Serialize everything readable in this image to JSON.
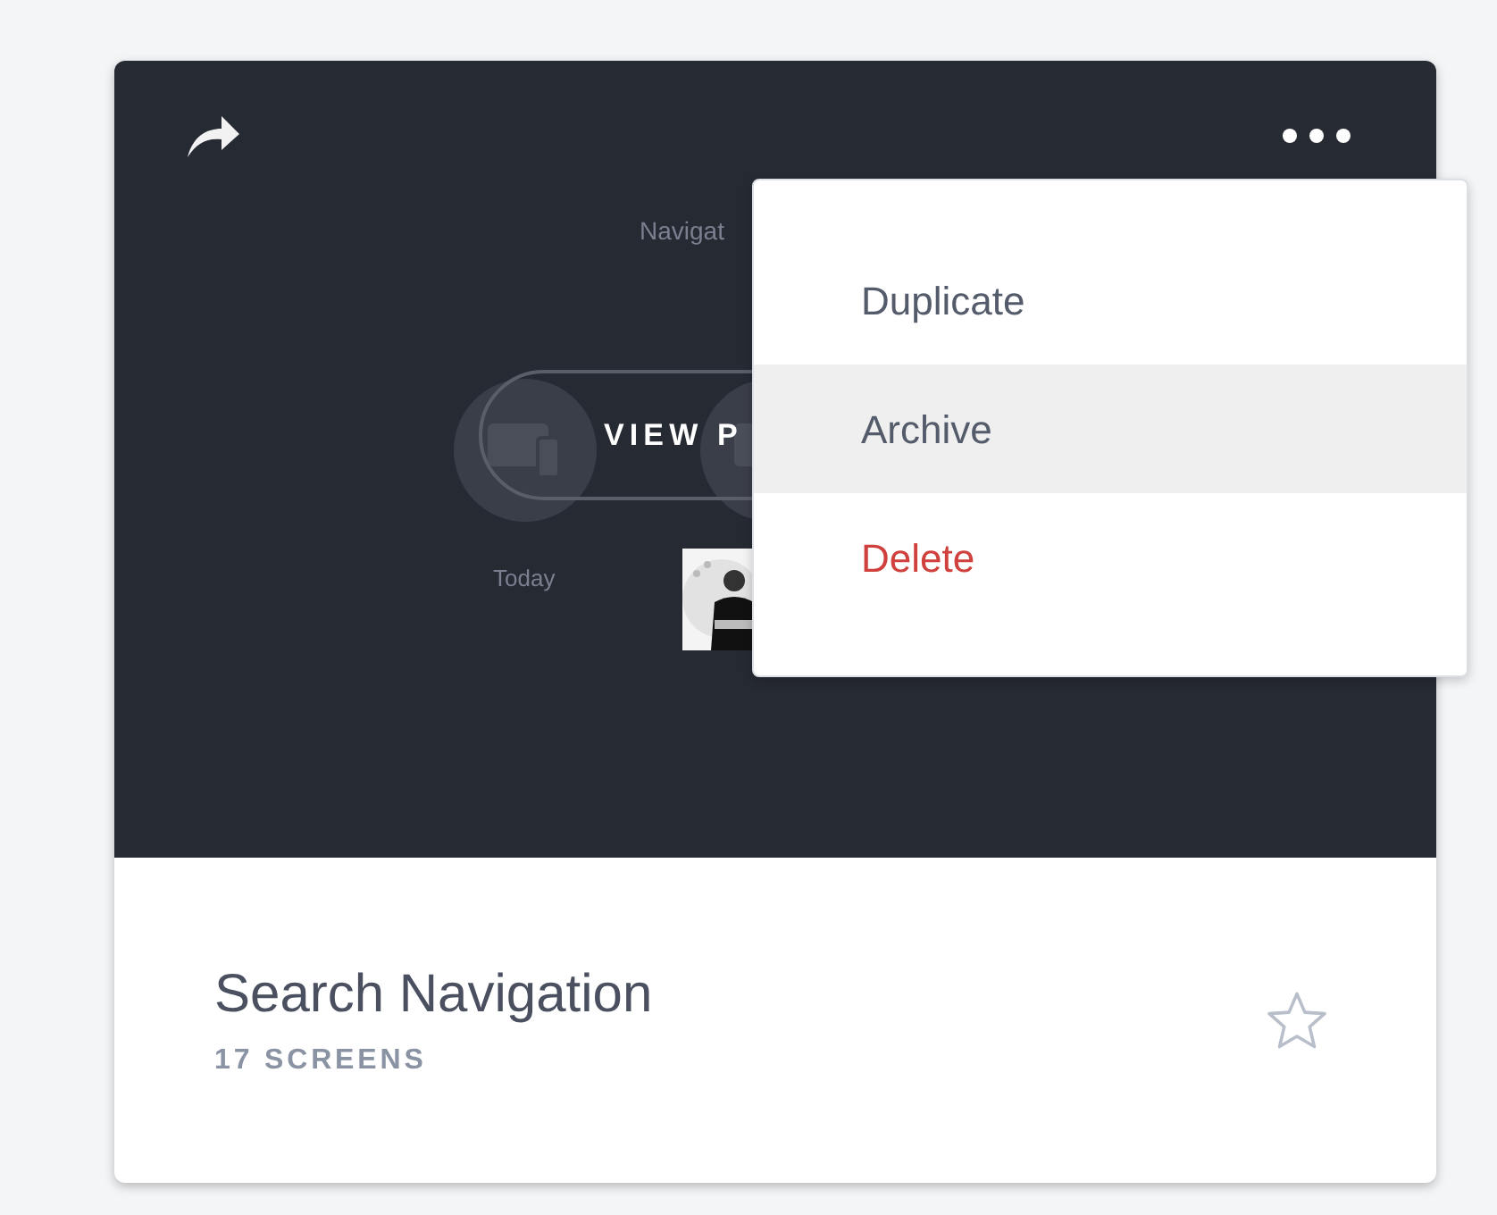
{
  "preview": {
    "hint": "Navigat",
    "button": "VIEW P",
    "caption": "Today"
  },
  "menu": {
    "items": [
      {
        "label": "Duplicate",
        "selected": false,
        "kind": "normal"
      },
      {
        "label": "Archive",
        "selected": true,
        "kind": "normal"
      },
      {
        "label": "Delete",
        "selected": false,
        "kind": "danger"
      }
    ]
  },
  "project": {
    "title": "Search Navigation",
    "count": "17 SCREENS",
    "starred": false
  }
}
